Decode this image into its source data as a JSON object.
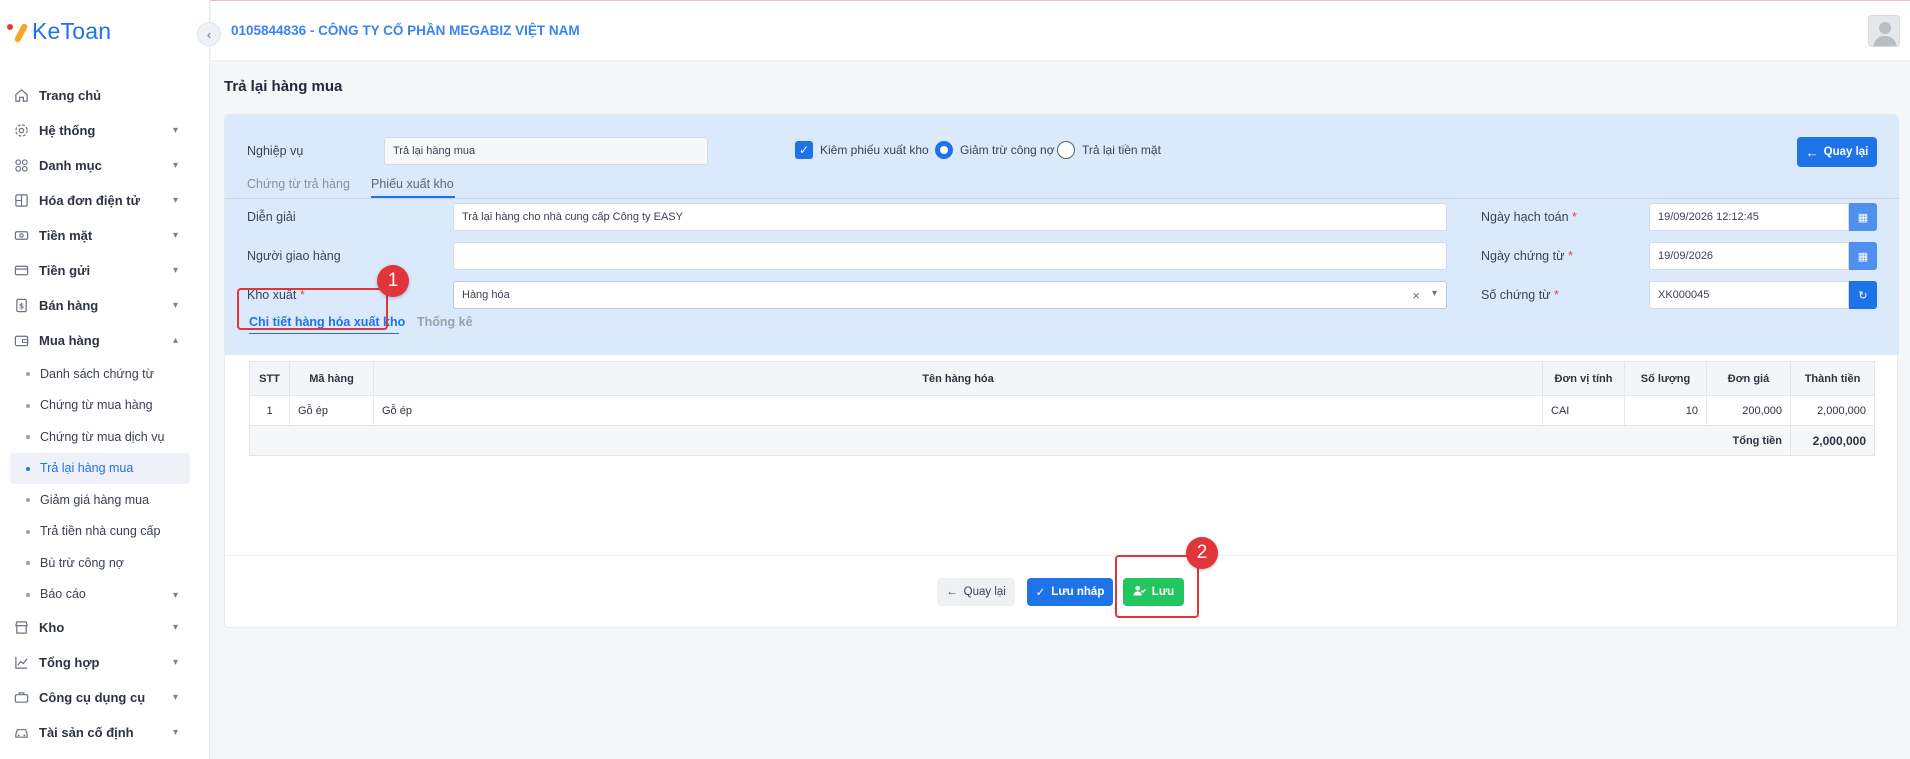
{
  "app": {
    "logo_text": "KeToan"
  },
  "header": {
    "company": "0105844836 - CÔNG TY CỔ PHẦN MEGABIZ VIỆT NAM"
  },
  "sidebar": {
    "items": [
      {
        "label": "Trang chủ",
        "icon": "home-icon",
        "chevron": false
      },
      {
        "label": "Hệ thống",
        "icon": "gear-icon",
        "chevron": true
      },
      {
        "label": "Danh mục",
        "icon": "grid-icon",
        "chevron": true
      },
      {
        "label": "Hóa đơn điện tử",
        "icon": "invoice-icon",
        "chevron": true
      },
      {
        "label": "Tiền mặt",
        "icon": "cash-icon",
        "chevron": true
      },
      {
        "label": "Tiền gửi",
        "icon": "card-icon",
        "chevron": true
      },
      {
        "label": "Bán hàng",
        "icon": "sale-icon",
        "chevron": true
      },
      {
        "label": "Mua hàng",
        "icon": "wallet-icon",
        "chevron": true,
        "expanded": true
      }
    ],
    "purchase_sub": [
      {
        "label": "Danh sách chứng từ"
      },
      {
        "label": "Chứng từ mua hàng"
      },
      {
        "label": "Chứng từ mua dịch vụ"
      },
      {
        "label": "Trả lại hàng mua",
        "active": true
      },
      {
        "label": "Giảm giá hàng mua"
      },
      {
        "label": "Trả tiền nhà cung cấp"
      },
      {
        "label": "Bù trừ công nợ"
      },
      {
        "label": "Báo cáo",
        "chevron": true
      }
    ],
    "bottom_items": [
      {
        "label": "Kho",
        "icon": "store-icon"
      },
      {
        "label": "Tổng hợp",
        "icon": "chart-icon"
      },
      {
        "label": "Công cụ dụng cụ",
        "icon": "tools-icon"
      },
      {
        "label": "Tài sản cố định",
        "icon": "car-icon"
      }
    ]
  },
  "page": {
    "title": "Trả lại hàng mua"
  },
  "form": {
    "nghiep_vu_label": "Nghiệp vụ",
    "nghiep_vu_value": "Trả lại hàng mua",
    "kiem_phieu_label": "Kiêm phiếu xuất kho",
    "kiem_phieu_checked": true,
    "radio_giam_tru": "Giảm trừ công nợ",
    "radio_tra_lai": "Trả lại tiền mặt",
    "back_button": "Quay lại",
    "tabs": [
      "Chứng từ trả hàng",
      "Phiếu xuất kho"
    ],
    "dien_giai_label": "Diễn giải",
    "dien_giai_value": "Trả lại hàng cho nhà cung cấp Công ty EASY",
    "nguoi_giao_label": "Người giao hàng",
    "nguoi_giao_value": "",
    "kho_xuat_label": "Kho xuất",
    "kho_xuat_value": "Hàng hóa",
    "ngay_hach_toan_label": "Ngày hạch toán",
    "ngay_hach_toan_value": "19/09/2026 12:12:45",
    "ngay_chung_tu_label": "Ngày chứng từ",
    "ngay_chung_tu_value": "19/09/2026",
    "so_chung_tu_label": "Số chứng từ",
    "so_chung_tu_value": "XK000045",
    "required_mark": "*"
  },
  "details": {
    "tabs": [
      "Chi tiết hàng hóa xuất kho",
      "Thống kê"
    ],
    "columns": [
      "STT",
      "Mã hàng",
      "Tên hàng hóa",
      "Đơn vị tính",
      "Số lượng",
      "Đơn giá",
      "Thành tiền"
    ],
    "rows": [
      {
        "stt": "1",
        "ma": "Gỗ ép",
        "ten": "Gỗ ép",
        "dvt": "CAI",
        "sl": "10",
        "dg": "200,000",
        "tt": "2,000,000"
      }
    ],
    "total_label": "Tổng tiền",
    "total_value": "2,000,000"
  },
  "footer": {
    "back": "Quay lại",
    "draft": "Lưu nháp",
    "save": "Lưu"
  },
  "annotations": [
    "1",
    "2"
  ],
  "colors": {
    "primary": "#1e73e8",
    "success": "#22c55e",
    "annotation": "#e0353b",
    "panel": "#dbe9fd"
  }
}
